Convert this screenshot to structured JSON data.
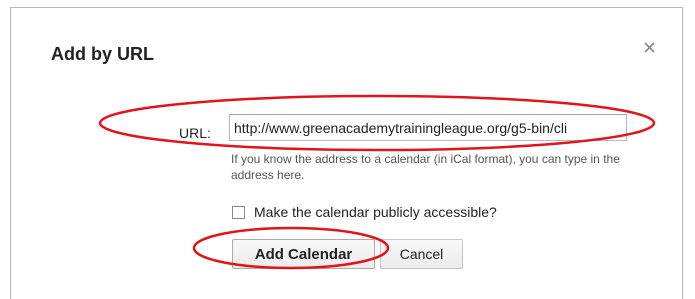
{
  "dialog": {
    "title": "Add by URL",
    "close_icon": "close-icon"
  },
  "form": {
    "url_label": "URL:",
    "url_value": "http://www.greenacademytrainingleague.org/g5-bin/cli",
    "help_text": "If you know the address to a calendar (in iCal format), you can type in the address here.",
    "public_checkbox_label": "Make the calendar publicly accessible?",
    "public_checked": false
  },
  "buttons": {
    "add_label": "Add Calendar",
    "cancel_label": "Cancel"
  },
  "annotation": {
    "color": "#e0151b"
  }
}
